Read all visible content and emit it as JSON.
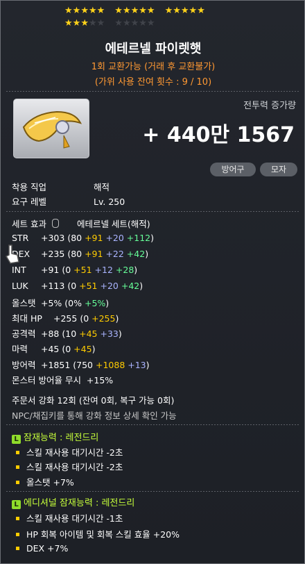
{
  "stars": {
    "filled": 18,
    "total": 25
  },
  "item": {
    "name": "에테르넬 파이렛햇",
    "trade": "1회 교환가능 (거래 후 교환불가)",
    "scissors": "(가위 사용 잔여 횟수 : 9 / 10)",
    "icon": "eternal-pirate-hat-icon"
  },
  "combat_power": {
    "label": "전투력 증가량",
    "value": "+ 440만 1567"
  },
  "tags": [
    "방어구",
    "모자"
  ],
  "requirements": [
    {
      "label": "착용 직업",
      "value": "해적"
    },
    {
      "label": "요구 레벨",
      "value": "Lv. 250"
    }
  ],
  "set_effect": {
    "label": "세트 효과",
    "value": "에테르넬 세트(해적)"
  },
  "stats": [
    {
      "label": "STR",
      "total": "+303",
      "base": "80",
      "star": "+91",
      "flame": "+20",
      "scroll": "+112"
    },
    {
      "label": "DEX",
      "total": "+235",
      "base": "80",
      "star": "+91",
      "flame": "+22",
      "scroll": "+42"
    },
    {
      "label": "INT",
      "total": "+91",
      "base": "0",
      "star": "+51",
      "flame": "+12",
      "scroll": "+28"
    },
    {
      "label": "LUK",
      "total": "+113",
      "base": "0",
      "star": "+51",
      "flame": "+20",
      "scroll": "+42"
    },
    {
      "label": "올스탯",
      "total": "+5%",
      "base": "0%",
      "scroll": "+5%"
    },
    {
      "label": "최대 HP",
      "total": "+255",
      "base": "0",
      "star": "+255"
    },
    {
      "label": "공격력",
      "total": "+88",
      "base": "10",
      "star": "+45",
      "flame": "+33"
    },
    {
      "label": "마력",
      "total": "+45",
      "base": "0",
      "star": "+45"
    },
    {
      "label": "방어력",
      "total": "+1851",
      "base": "750",
      "star": "+1088",
      "flame": "+13"
    }
  ],
  "ignore_def": {
    "label": "몬스터 방어율 무시",
    "value": "+15%"
  },
  "enhance": "주문서 강화 12회 (잔여 0회, 복구 가능 0회)",
  "npc_note": "NPC/채집키를 통해 강화 정보 상세 확인 가능",
  "potential": {
    "title": "잠재능력 : 레전드리",
    "lines": [
      "스킬 재사용 대기시간 -2초",
      "스킬 재사용 대기시간 -2초",
      "올스탯 +7%"
    ]
  },
  "additional": {
    "title": "에디셔널 잠재능력 : 레전드리",
    "lines": [
      "스킬 재사용 대기시간 -1초",
      "HP 회복 아이템 및 회복 스킬 효율 +20%",
      "DEX +7%"
    ]
  },
  "colors": {
    "star": "#ffd21a",
    "potential_badge": "#8fdc2b",
    "trade_text": "#ff9933"
  }
}
